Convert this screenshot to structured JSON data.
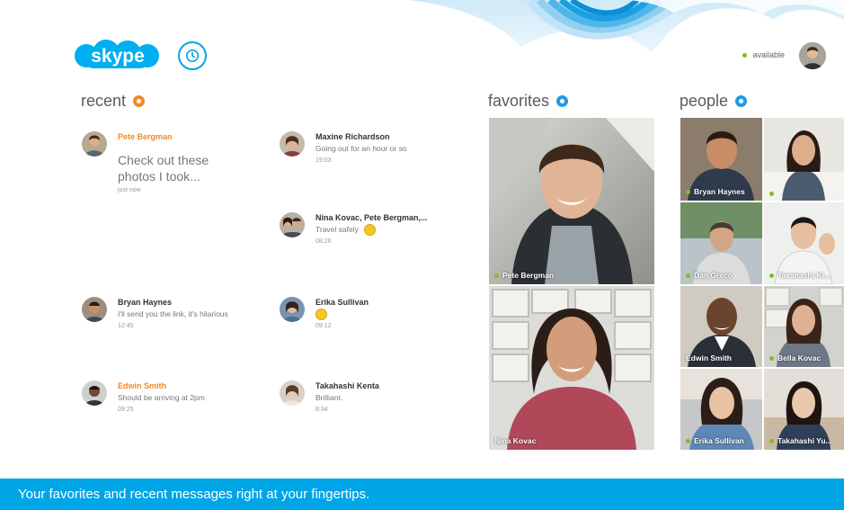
{
  "app": {
    "logo_text": "skype",
    "status_label": "available"
  },
  "colors": {
    "brand_blue": "#00a5e6",
    "unread_orange": "#f2882a",
    "presence_green": "#7dc01a"
  },
  "icons": {
    "call": "phone-icon",
    "recent_marker": "orange-dot-icon",
    "favorites_marker": "blue-dot-icon",
    "people_marker": "blue-dot-icon"
  },
  "recent": {
    "title": "recent",
    "items": [
      {
        "name": "Pete Bergman",
        "unread": true,
        "text": "Check out these photos I took...",
        "time": "just now"
      },
      {
        "name": "Maxine Richardson",
        "unread": false,
        "text": "Going out for an hour or so",
        "time": "19:03"
      },
      {
        "name": "Nina Kovac, Pete Bergman,...",
        "unread": false,
        "text": "Travel safely",
        "time": "08:26"
      },
      {
        "name": "Bryan Haynes",
        "unread": false,
        "text": "I'll send you the link, it's hilarious",
        "time": "12:45"
      },
      {
        "name": "Erika Sullivan",
        "unread": false,
        "text": "",
        "time": "09:12"
      },
      {
        "name": "Edwin Smith",
        "unread": true,
        "text": "Should be arriving at 2pm",
        "time": "09:25"
      },
      {
        "name": "Takahashi Kenta",
        "unread": false,
        "text": "Brilliant.",
        "time": "8:34"
      }
    ]
  },
  "favorites": {
    "title": "favorites",
    "items": [
      {
        "name": "Pete Bergman"
      },
      {
        "name": "Nina Kovac"
      }
    ]
  },
  "people": {
    "title": "people",
    "items": [
      {
        "name": "Bryan Haynes"
      },
      {
        "name": ""
      },
      {
        "name": "Dan Greco"
      },
      {
        "name": "Takahashi Ki..."
      },
      {
        "name": "Edwin Smith"
      },
      {
        "name": "Bella Kovac"
      },
      {
        "name": "Erika Sullivan"
      },
      {
        "name": "Takahashi Yu..."
      }
    ]
  },
  "banner": {
    "text": "Your favorites and recent messages right at your fingertips."
  }
}
